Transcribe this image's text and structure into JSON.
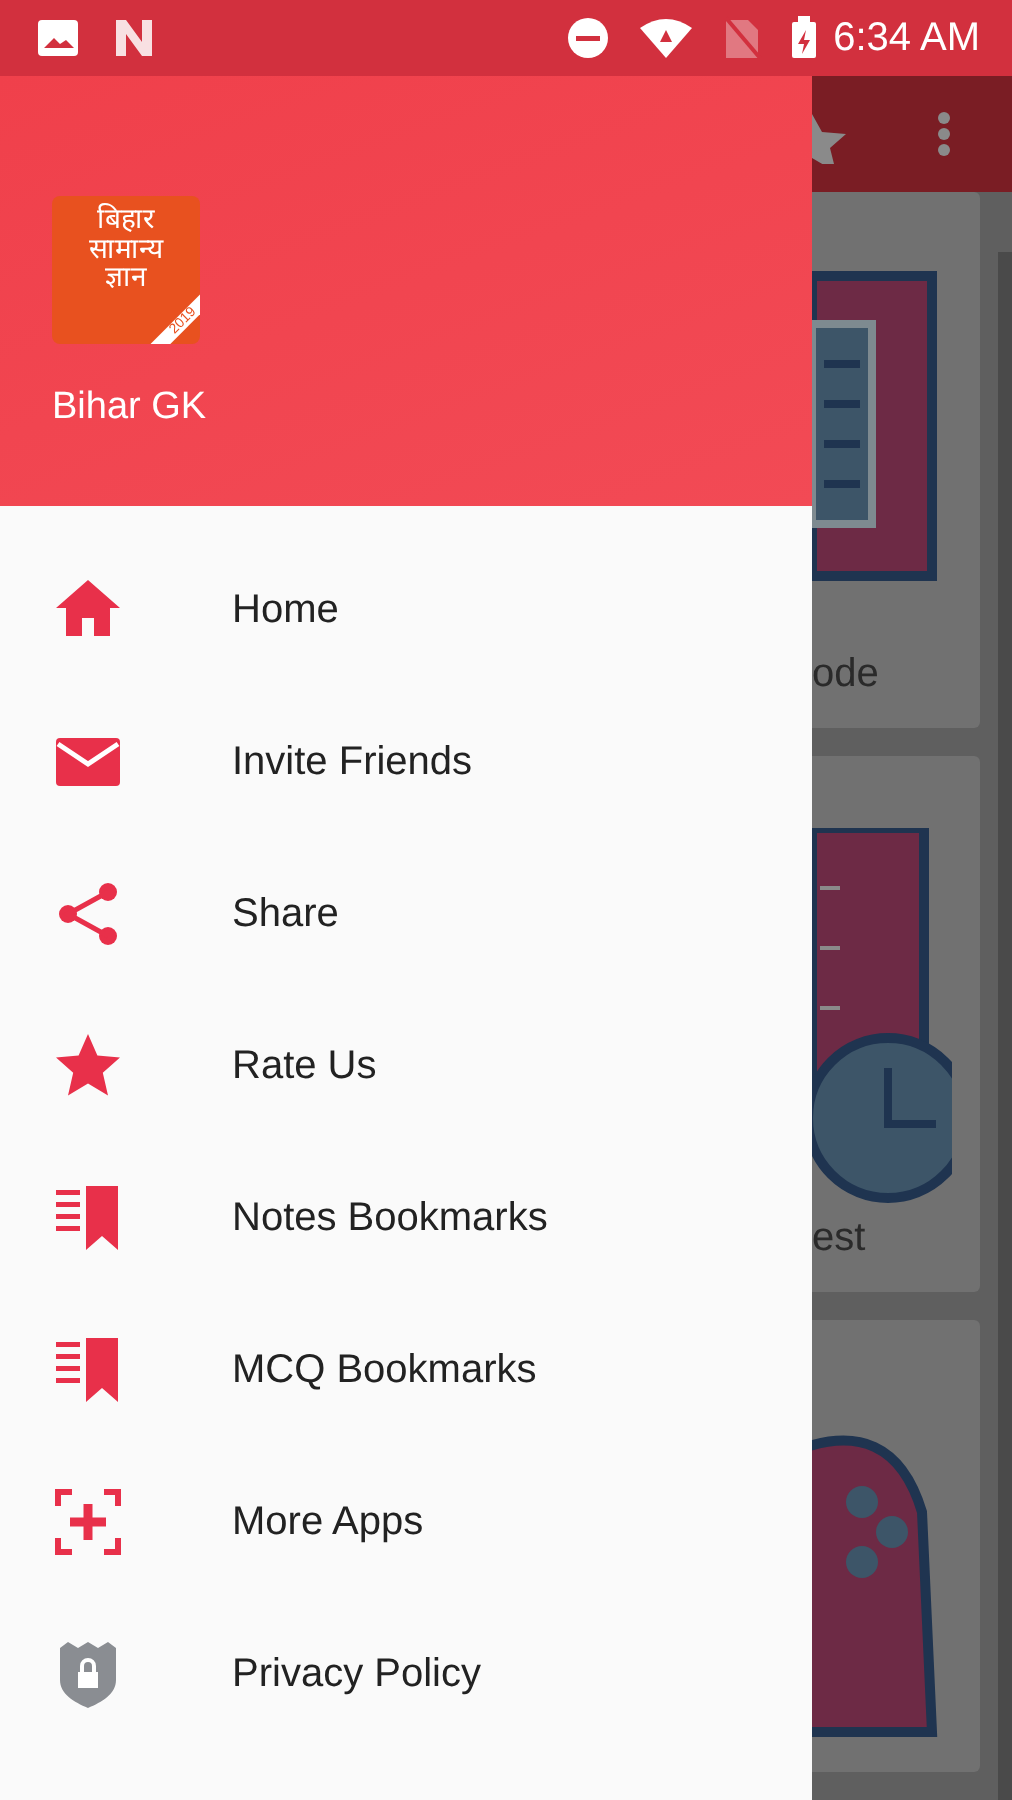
{
  "status_bar": {
    "time": "6:34 AM"
  },
  "drawer": {
    "logo": {
      "lines": [
        "बिहार",
        "सामान्य",
        "ज्ञान"
      ],
      "ribbon": "2019"
    },
    "app_name": "Bihar GK",
    "items": [
      {
        "label": "Home",
        "kind": "home"
      },
      {
        "label": "Invite Friends",
        "kind": "mail"
      },
      {
        "label": "Share",
        "kind": "share"
      },
      {
        "label": "Rate Us",
        "kind": "star"
      },
      {
        "label": "Notes Bookmarks",
        "kind": "bookmark"
      },
      {
        "label": "MCQ Bookmarks",
        "kind": "bookmark"
      },
      {
        "label": "More Apps",
        "kind": "add"
      },
      {
        "label": "Privacy Policy",
        "kind": "shield"
      }
    ]
  },
  "background_screen": {
    "cards": [
      {
        "label": "ode",
        "kind": "notes"
      },
      {
        "label": "est",
        "kind": "timer"
      },
      {
        "kind": "game"
      }
    ]
  }
}
